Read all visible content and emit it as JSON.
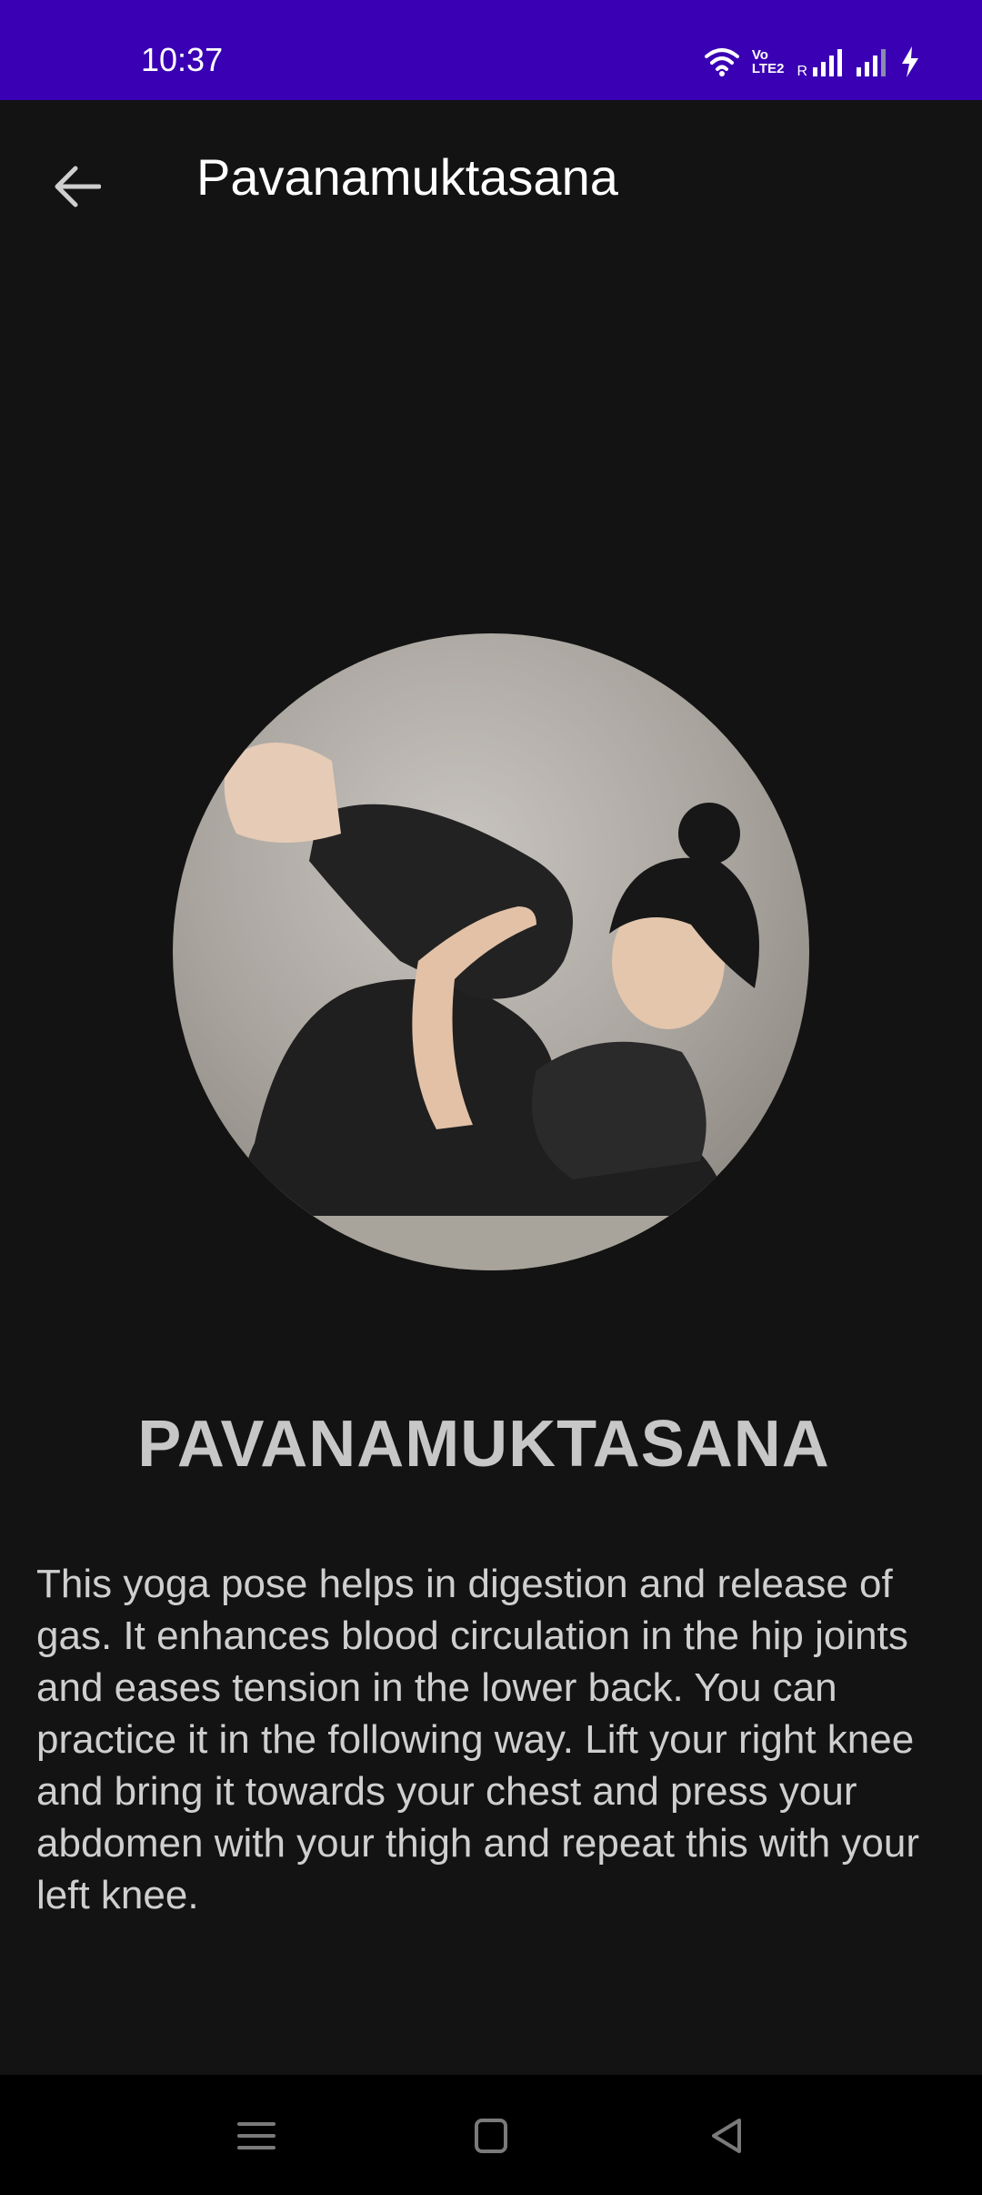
{
  "status_bar": {
    "time": "10:37",
    "volte_top": "Vo",
    "volte_bottom": "LTE2",
    "roaming": "R",
    "icons": [
      "wifi-icon",
      "volte-icon",
      "signal-icon",
      "signal-icon",
      "charging-icon"
    ]
  },
  "app_bar": {
    "title": "Pavanamuktasana",
    "back_icon": "arrow-left-icon"
  },
  "pose": {
    "image": "woman-doing-pavanamuktasana-photo",
    "title": "PAVANAMUKTASANA",
    "description": "This yoga pose helps in digestion and release of gas. It enhances blood circulation in the hip joints and eases tension in the lower back. You can practice it in the following way. Lift your right knee and bring it towards your chest and press your abdomen with your thigh and repeat this with your left knee."
  },
  "nav_bar": {
    "buttons": [
      "menu-icon",
      "home-icon",
      "back-triangle-icon"
    ]
  },
  "colors": {
    "status_bar": "#3a00b4",
    "background": "#131313",
    "title_text": "#c7c7c7",
    "body_text": "#cfcfcf"
  }
}
